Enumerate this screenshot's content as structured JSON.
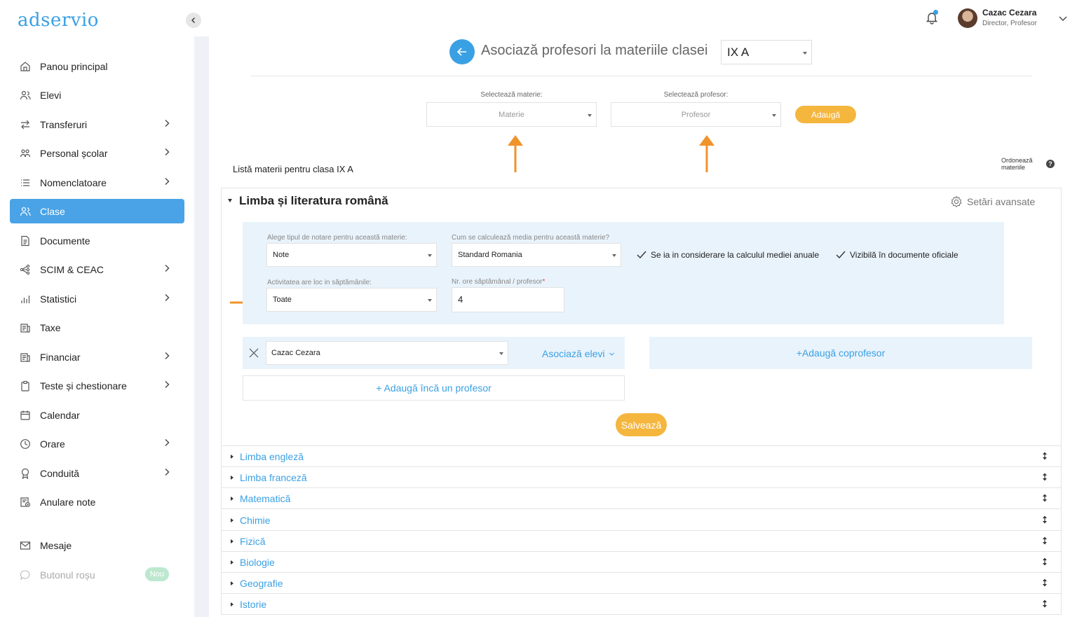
{
  "brand": {
    "logo": "adservio",
    "accent": "#4aa3e6",
    "button_color": "#f5b63e"
  },
  "sidebar": {
    "items": [
      {
        "label": "Panou principal",
        "icon": "home-icon",
        "chevron": false
      },
      {
        "label": "Elevi",
        "icon": "users-icon",
        "chevron": false
      },
      {
        "label": "Transferuri",
        "icon": "transfer-icon",
        "chevron": true
      },
      {
        "label": "Personal școlar",
        "icon": "staff-icon",
        "chevron": true
      },
      {
        "label": "Nomenclatoare",
        "icon": "list-icon",
        "chevron": true
      },
      {
        "label": "Clase",
        "icon": "class-icon",
        "chevron": false,
        "active": true
      },
      {
        "label": "Documente",
        "icon": "document-icon",
        "chevron": false
      },
      {
        "label": "SCIM & CEAC",
        "icon": "network-icon",
        "chevron": true
      },
      {
        "label": "Statistici",
        "icon": "chart-icon",
        "chevron": true
      },
      {
        "label": "Taxe",
        "icon": "fees-icon",
        "chevron": false
      },
      {
        "label": "Financiar",
        "icon": "finance-icon",
        "chevron": true
      },
      {
        "label": "Teste și chestionare",
        "icon": "clipboard-icon",
        "chevron": true
      },
      {
        "label": "Calendar",
        "icon": "calendar-icon",
        "chevron": false
      },
      {
        "label": "Orare",
        "icon": "clock-icon",
        "chevron": true
      },
      {
        "label": "Conduită",
        "icon": "award-icon",
        "chevron": true
      },
      {
        "label": "Anulare note",
        "icon": "cancel-grades-icon",
        "chevron": false
      }
    ],
    "messages": "Mesaje",
    "red_button": "Butonul roșu",
    "new_badge": "Nou"
  },
  "user": {
    "name": "Cazac Cezara",
    "role": "Director, Profesor"
  },
  "header": {
    "title": "Asociază profesori la materiile clasei",
    "class_value": "IX A"
  },
  "filters": {
    "subject_label": "Selectează materie:",
    "subject_placeholder": "Materie",
    "teacher_label": "Selectează profesor:",
    "teacher_placeholder": "Profesor",
    "add_button": "Adaugă"
  },
  "list": {
    "title": "Listă materii pentru clasa IX A",
    "order_label_1": "Ordonează",
    "order_label_2": "materiile",
    "help": "?"
  },
  "subject": {
    "name": "Limba și literatura română",
    "advanced": "Setări avansate",
    "grading_label": "Alege tipul de notare pentru această materie:",
    "grading_value": "Note",
    "average_label": "Cum se calculează media pentru această materie?",
    "average_value": "Standard Romania",
    "chk_annual": "Se ia in considerare la calculul mediei anuale",
    "chk_official": "Vizibilă în documente oficiale",
    "weeks_label": "Activitatea are loc in săptămânile:",
    "weeks_value": "Toate",
    "hours_label": "Nr. ore săptămânal / profesor",
    "hours_required": "*",
    "hours_value": "4",
    "teacher_value": "Cazac Cezara",
    "assoc_students": "Asociază elevi",
    "add_coteacher": "+Adaugă coprofesor",
    "add_teacher": "+ Adaugă încă un profesor",
    "save": "Salvează"
  },
  "subjects": [
    "Limba engleză",
    "Limba franceză",
    "Matematică",
    "Chimie",
    "Fizică",
    "Biologie",
    "Geografie",
    "Istorie"
  ]
}
